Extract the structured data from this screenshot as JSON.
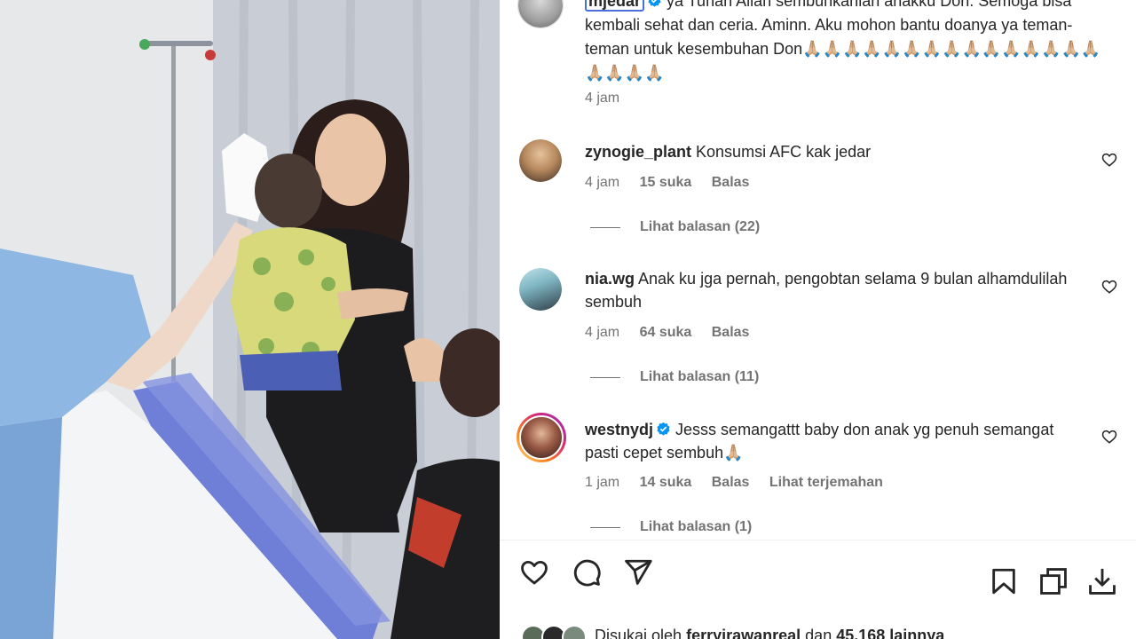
{
  "post": {
    "author": "mjedar",
    "caption_text": "ya Tuhan Allah sembuhkanlah anakku Don. Semoga bisa kembali sehat dan ceria. Aminn. Aku mohon bantu doanya ya teman-teman untuk kesembuhan Don🙏🏼🙏🏼🙏🏼🙏🏼🙏🏼🙏🏼🙏🏼🙏🏼🙏🏼🙏🏼🙏🏼🙏🏼🙏🏼🙏🏼🙏🏼🙏🏼🙏🏼🙏🏼🙏🏼",
    "time": "4 jam"
  },
  "comments": [
    {
      "username": "zynogie_plant",
      "text": "Konsumsi AFC kak jedar",
      "time": "4 jam",
      "likes": "15 suka",
      "reply": "Balas",
      "view_replies": "Lihat balasan (22)"
    },
    {
      "username": "nia.wg",
      "text": "Anak ku jga pernah, pengobtan selama 9 bulan alhamdulilah sembuh",
      "time": "4 jam",
      "likes": "64 suka",
      "reply": "Balas",
      "view_replies": "Lihat balasan (11)"
    },
    {
      "username": "westnydj",
      "text": "Jesss semangattt baby don anak yg penuh semangat pasti cepet sembuh🙏🏼",
      "time": "1 jam",
      "likes": "14 suka",
      "reply": "Balas",
      "translate": "Lihat terjemahan",
      "view_replies": "Lihat balasan (1)"
    }
  ],
  "likes_line": {
    "prefix": "Disukai oleh",
    "user": "ferryirawanreal",
    "middle": "dan",
    "count": "45.168 lainnya"
  },
  "icons": {
    "like": "heart-icon",
    "comment": "comment-icon",
    "share": "share-icon",
    "save": "bookmark-icon",
    "multi": "copy-icon",
    "download": "download-icon"
  },
  "colors": {
    "verified": "#0095f6",
    "muted": "#737373",
    "text": "#262626",
    "story_ring": "#d62976"
  }
}
